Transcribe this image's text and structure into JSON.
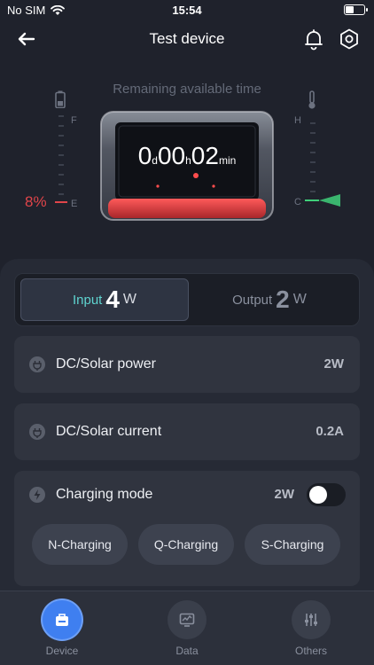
{
  "status_bar": {
    "carrier": "No SIM",
    "time": "15:54"
  },
  "header": {
    "title": "Test device"
  },
  "hero": {
    "remaining_label": "Remaining available time",
    "time": {
      "days": "0",
      "days_unit": "d",
      "hours": "00",
      "hours_unit": "h",
      "minutes": "02",
      "minutes_unit": "min"
    },
    "battery_percent": "8%",
    "battery_level_fraction": 0.08,
    "gauge_left": {
      "top_letter": "F",
      "bottom_letter": "E"
    },
    "gauge_right": {
      "top_letter": "H",
      "bottom_letter": "C"
    }
  },
  "io": {
    "input": {
      "label": "Input",
      "value": "4",
      "unit": "W"
    },
    "output": {
      "label": "Output",
      "value": "2",
      "unit": "W"
    }
  },
  "rows": [
    {
      "label": "DC/Solar power",
      "value": "2W"
    },
    {
      "label": "DC/Solar current",
      "value": "0.2A"
    }
  ],
  "charging": {
    "label": "Charging mode",
    "value": "2W",
    "toggle_on": false,
    "modes": [
      "N-Charging",
      "Q-Charging",
      "S-Charging"
    ]
  },
  "nav": {
    "items": [
      {
        "label": "Device",
        "active": true
      },
      {
        "label": "Data",
        "active": false
      },
      {
        "label": "Others",
        "active": false
      }
    ]
  },
  "colors": {
    "accent_input": "#5fd4d0",
    "battery_red": "#e0454a",
    "temp_green": "#3fcf7a",
    "nav_active": "#3f7ff0"
  }
}
